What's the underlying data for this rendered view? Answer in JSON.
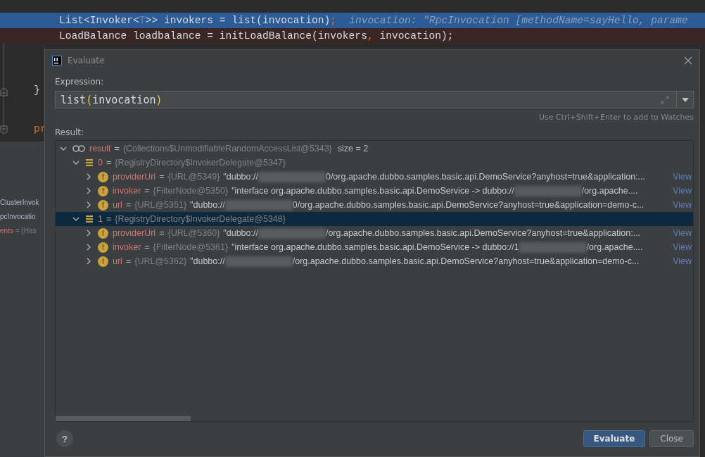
{
  "editor": {
    "lines": [
      {
        "selected": true,
        "tokens": [
          {
            "kind": "code",
            "text": "List<Invoker<"
          },
          {
            "kind": "faint",
            "text": "T"
          },
          {
            "kind": "code",
            "text": ">> invokers = list(invocation)"
          },
          {
            "kind": "punct",
            "text": ";"
          },
          {
            "kind": "hint",
            "text": "invocation: \"RpcInvocation [methodName=sayHello, parame"
          }
        ]
      },
      {
        "selected": false,
        "tokens": [
          {
            "kind": "code",
            "text": "LoadBalance loadbalance = initLoadBalance(invokers"
          },
          {
            "kind": "punct",
            "text": ","
          },
          {
            "kind": "code",
            "text": " invocation);"
          }
        ]
      }
    ],
    "brace": "}",
    "keyword": "pr"
  },
  "variables": [
    {
      "name": "ClusterInvok"
    },
    {
      "name": "pcInvocatio"
    },
    {
      "name": "ents",
      "value": "= {Has"
    }
  ],
  "dialog": {
    "title": "Evaluate",
    "expression_label": "Expression:",
    "expression": {
      "head": "list",
      "open": "(",
      "arg": "invocation",
      "close": ")"
    },
    "hint": "Use Ctrl+Shift+Enter to add to Watches",
    "result_label": "Result:",
    "tree": [
      {
        "kind": "watch",
        "name": "result",
        "sep": "=",
        "ref": "{Collections$UnmodifiableRandomAccessList@5343}",
        "extra": "size = 2",
        "expanded": true,
        "selected": false,
        "children": [
          {
            "kind": "array",
            "name": "0",
            "sep": "=",
            "ref": "{RegistryDirectory$InvokerDelegate@5347}",
            "expanded": true,
            "selected": false,
            "children": [
              {
                "kind": "field",
                "badge": "f",
                "name": "providerUrl",
                "sep": "=",
                "ref": "{URL@5349}",
                "value": "\"dubbo://",
                "value_rest": "0/org.apache.dubbo.samples.basic.api.DemoService?anyhost=true&application:...",
                "link": "View",
                "expanded": false,
                "selected": false
              },
              {
                "kind": "field",
                "badge": "f",
                "name": "invoker",
                "sep": "=",
                "ref": "{FilterNode@5350}",
                "value": "\"interface org.apache.dubbo.samples.basic.api.DemoService -> dubbo://",
                "value_rest": "/org.apache....",
                "link": "View",
                "expanded": false,
                "selected": false
              },
              {
                "kind": "field",
                "badge": "f",
                "name": "url",
                "sep": "=",
                "ref": "{URL@5351}",
                "value": "\"dubbo://",
                "value_rest": "0/org.apache.dubbo.samples.basic.api.DemoService?anyhost=true&application=demo-c...",
                "link": "View",
                "expanded": false,
                "selected": false
              }
            ]
          },
          {
            "kind": "array",
            "name": "1",
            "sep": "=",
            "ref": "{RegistryDirectory$InvokerDelegate@5348}",
            "expanded": true,
            "selected": true,
            "children": [
              {
                "kind": "field",
                "badge": "f",
                "name": "providerUrl",
                "sep": "=",
                "ref": "{URL@5360}",
                "value": "\"dubbo://",
                "value_rest": "/org.apache.dubbo.samples.basic.api.DemoService?anyhost=true&application:...",
                "link": "View",
                "expanded": false,
                "selected": false
              },
              {
                "kind": "field",
                "badge": "f",
                "name": "invoker",
                "sep": "=",
                "ref": "{FilterNode@5361}",
                "value": "\"interface org.apache.dubbo.samples.basic.api.DemoService -> dubbo://1",
                "value_rest": "/org.apache....",
                "link": "View",
                "expanded": false,
                "selected": false
              },
              {
                "kind": "field",
                "badge": "f",
                "name": "url",
                "sep": "=",
                "ref": "{URL@5362}",
                "value": "\"dubbo://",
                "value_rest": "/org.apache.dubbo.samples.basic.api.DemoService?anyhost=true&application=demo-c...",
                "link": "View",
                "expanded": false,
                "selected": false
              }
            ]
          }
        ]
      }
    ],
    "help": "?",
    "buttons": [
      {
        "label": "Evaluate",
        "primary": true
      },
      {
        "label": "Close",
        "primary": false
      }
    ]
  }
}
